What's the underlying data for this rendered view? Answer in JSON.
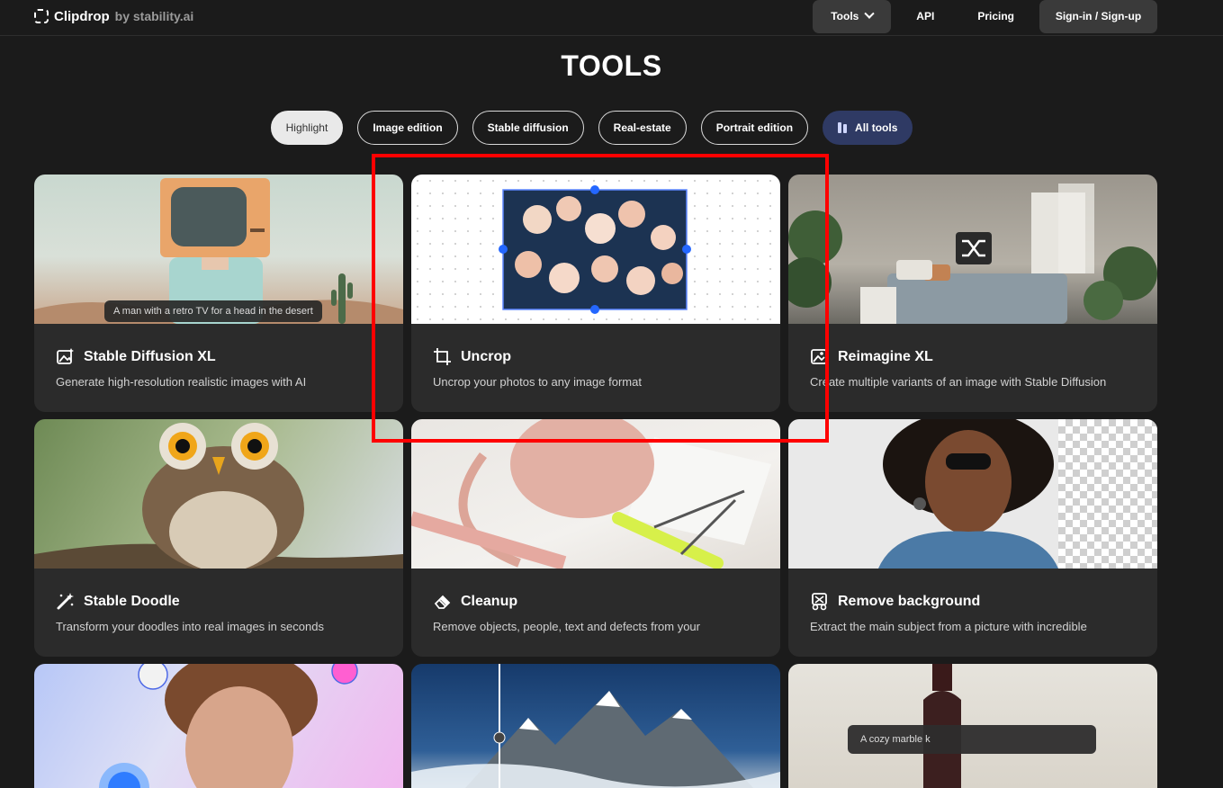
{
  "header": {
    "brand": "Clipdrop",
    "by": "by stability.ai",
    "nav": {
      "tools": "Tools",
      "api": "API",
      "pricing": "Pricing",
      "signin": "Sign-in / Sign-up"
    }
  },
  "title": "TOOLS",
  "filters": [
    {
      "label": "Highlight",
      "active": true
    },
    {
      "label": "Image edition"
    },
    {
      "label": "Stable diffusion"
    },
    {
      "label": "Real-estate"
    },
    {
      "label": "Portrait edition"
    },
    {
      "label": "All tools"
    }
  ],
  "cards": [
    {
      "title": "Stable Diffusion XL",
      "desc": "Generate high-resolution realistic images with AI",
      "caption": "A man with a retro TV for a head in the desert",
      "icon": "image-sparkle-icon"
    },
    {
      "title": "Uncrop",
      "desc": "Uncrop your photos to any image format",
      "icon": "crop-icon"
    },
    {
      "title": "Reimagine XL",
      "desc": "Create multiple variants of an image with Stable Diffusion",
      "icon": "image-variants-icon"
    },
    {
      "title": "Stable Doodle",
      "desc": "Transform your doodles into real images in seconds",
      "icon": "magic-wand-icon"
    },
    {
      "title": "Cleanup",
      "desc": "Remove objects, people, text and defects from your",
      "icon": "eraser-icon"
    },
    {
      "title": "Remove background",
      "desc": "Extract the main subject from a picture with incredible",
      "icon": "remove-bg-icon"
    },
    {
      "caption": "A cozy marble k"
    }
  ],
  "colors": {
    "background": "#1b1b1b",
    "card": "#2b2b2b",
    "accent": "#2f3a64",
    "highlight_box": "#ff0000"
  }
}
